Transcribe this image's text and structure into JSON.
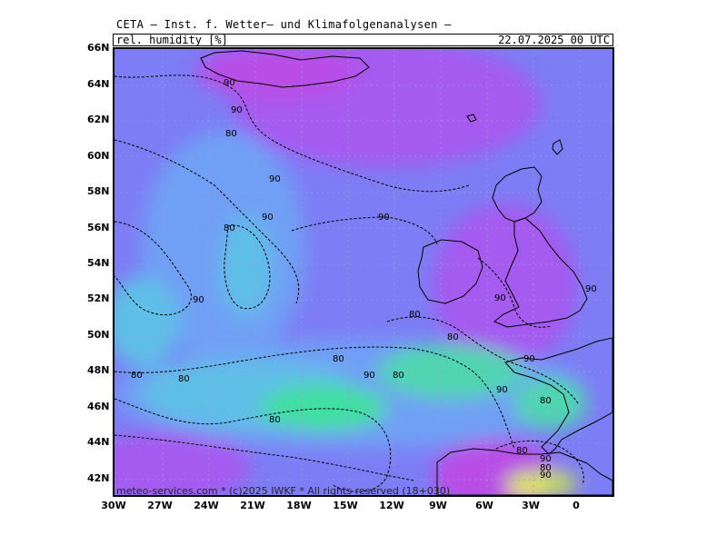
{
  "header": {
    "title": "CETA — Inst. f. Wetter— und Klimafolgenanalysen —",
    "parameter": "rel. humidity [%]",
    "datetime": "22.07.2025 00 UTC"
  },
  "copyright": "meteo-services.com * (c)2025 IWKF * All rights reserved (18+030)",
  "axes": {
    "lat_labels": [
      "66N",
      "64N",
      "62N",
      "60N",
      "58N",
      "56N",
      "54N",
      "52N",
      "50N",
      "48N",
      "46N",
      "44N",
      "42N"
    ],
    "lon_labels": [
      "30W",
      "27W",
      "24W",
      "21W",
      "18W",
      "15W",
      "12W",
      "9W",
      "6W",
      "3W",
      "0"
    ]
  },
  "contour_labels": [
    "90",
    "90",
    "90",
    "90",
    "80",
    "90",
    "90",
    "90",
    "80",
    "90",
    "80",
    "80",
    "80",
    "80",
    "90",
    "80",
    "90",
    "80",
    "80",
    "90",
    "80",
    "90",
    "80",
    "90",
    "80"
  ],
  "colors": {
    "rh_50": "#b94de6",
    "rh_60": "#a55af0",
    "rh_70": "#7d7df5",
    "rh_80": "#6fa0f5",
    "rh_90": "#5ebfe6",
    "rh_95": "#4fd6b0",
    "rh_100": "#3fe0a0",
    "dry_low": "#c8e050",
    "dry_lowest": "#f0ee3a",
    "coast": "#000000"
  }
}
